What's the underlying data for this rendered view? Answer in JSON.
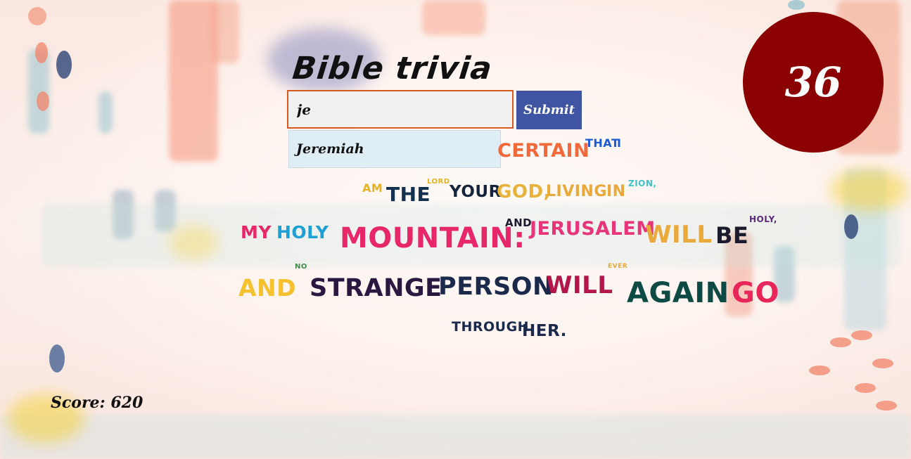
{
  "game": {
    "title": "Bible trivia",
    "search": {
      "value": "je",
      "placeholder": ""
    },
    "submit_label": "Submit",
    "suggestions": [
      "Jeremiah"
    ],
    "timer": "36",
    "score_text": "Score: 620"
  },
  "verse_words": [
    {
      "text": "certain",
      "color": "#f26a3b"
    },
    {
      "text": "that",
      "color": "#1e5bd6"
    },
    {
      "text": "I",
      "color": "#1e5bd6"
    },
    {
      "text": "am",
      "color": "#e6b227"
    },
    {
      "text": "the",
      "color": "#14304f"
    },
    {
      "text": "Lord",
      "color": "#e6b227"
    },
    {
      "text": "your",
      "color": "#13243b"
    },
    {
      "text": "God,",
      "color": "#e9b33b"
    },
    {
      "text": "living",
      "color": "#e9a93b"
    },
    {
      "text": "in",
      "color": "#e9a93b"
    },
    {
      "text": "Zion,",
      "color": "#3fc3c6"
    },
    {
      "text": "my",
      "color": "#e8266a"
    },
    {
      "text": "holy",
      "color": "#1e9fd6"
    },
    {
      "text": "mountain:",
      "color": "#e8266a"
    },
    {
      "text": "and",
      "color": "#1b1b2e"
    },
    {
      "text": "Jerusalem",
      "color": "#e8357a"
    },
    {
      "text": "will",
      "color": "#e9a93b"
    },
    {
      "text": "be",
      "color": "#1b1b2e"
    },
    {
      "text": "holy,",
      "color": "#5b2b7a"
    },
    {
      "text": "and",
      "color": "#f5c12f"
    },
    {
      "text": "no",
      "color": "#3f8c4a"
    },
    {
      "text": "strange",
      "color": "#2a1840"
    },
    {
      "text": "person",
      "color": "#1b2a4a"
    },
    {
      "text": "will",
      "color": "#b3164a"
    },
    {
      "text": "ever",
      "color": "#e9a93b"
    },
    {
      "text": "again",
      "color": "#0d4a44"
    },
    {
      "text": "go",
      "color": "#e8265a"
    },
    {
      "text": "through",
      "color": "#1b2a4a"
    },
    {
      "text": "her.",
      "color": "#1b2a4a"
    }
  ]
}
